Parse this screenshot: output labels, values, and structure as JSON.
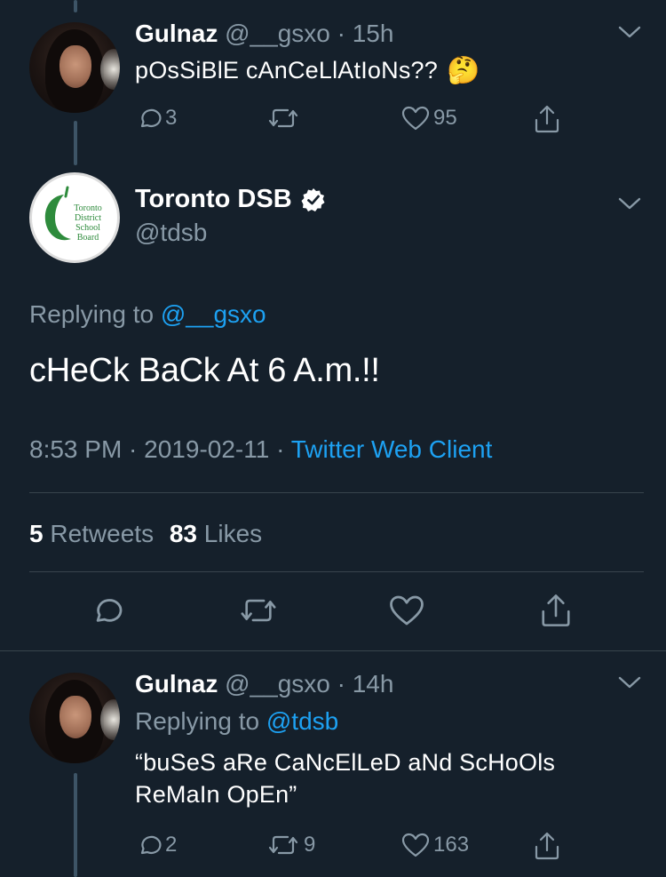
{
  "tweet1": {
    "name": "Gulnaz",
    "handle": "@__gsxo",
    "sep": "·",
    "time": "15h",
    "text": "pOsSiBlE cAnCeLlAtIoNs??",
    "emoji": "🤔",
    "replies": "3",
    "retweets": "",
    "likes": "95"
  },
  "main": {
    "name": "Toronto DSB",
    "handle": "@tdsb",
    "logo_text": [
      "Toronto",
      "District",
      "School",
      "Board"
    ],
    "replying_prefix": "Replying to",
    "replying_to": "@__gsxo",
    "text": "cHeCk BaCk At 6 A.m.!!",
    "timestamp": "8:53 PM · 2019-02-11 ·",
    "client": "Twitter Web Client",
    "retweet_count": "5",
    "retweet_label": "Retweets",
    "like_count": "83",
    "like_label": "Likes"
  },
  "tweet3": {
    "name": "Gulnaz",
    "handle": "@__gsxo",
    "sep": "·",
    "time": "14h",
    "replying_prefix": "Replying to",
    "replying_to": "@tdsb",
    "text_line1": "“buSeS aRe CaNcElLeD aNd ScHoOls",
    "text_line2": "ReMaIn OpEn”",
    "replies": "2",
    "retweets": "9",
    "likes": "163"
  },
  "colors": {
    "background": "#15202b",
    "muted": "#8899a6",
    "link": "#1da1f2",
    "divider": "#38444d",
    "logo_green": "#2e8b3c"
  },
  "icons": [
    "reply-icon",
    "retweet-icon",
    "like-icon",
    "share-icon",
    "chevron-down-icon",
    "verified-badge-icon"
  ]
}
